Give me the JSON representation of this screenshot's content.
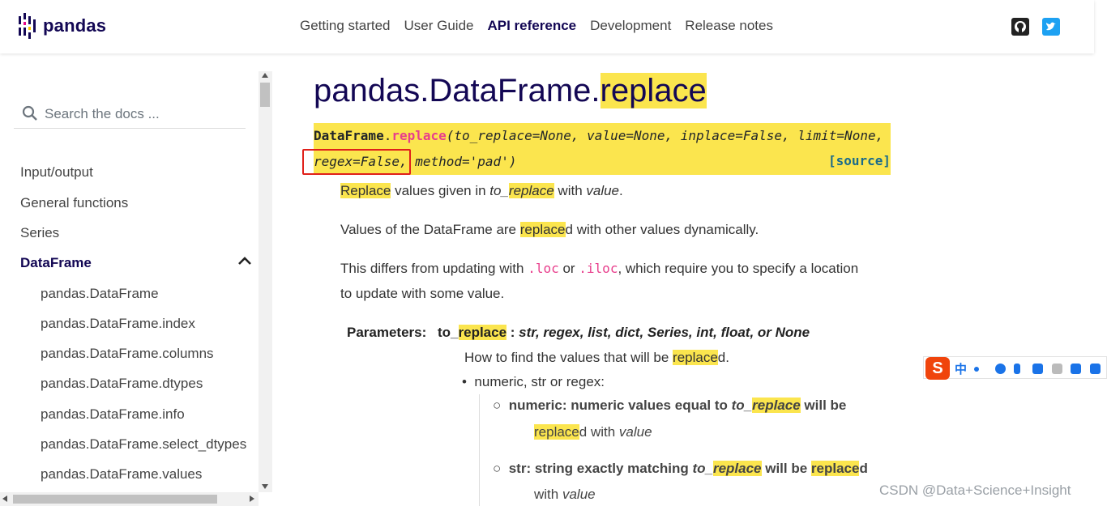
{
  "brand": {
    "name": "pandas",
    "color": "#130754"
  },
  "nav": {
    "links": [
      {
        "label": "Getting started",
        "active": false
      },
      {
        "label": "User Guide",
        "active": false
      },
      {
        "label": "API reference",
        "active": true
      },
      {
        "label": "Development",
        "active": false
      },
      {
        "label": "Release notes",
        "active": false
      }
    ],
    "icons": [
      "github-icon",
      "twitter-icon"
    ]
  },
  "sidebar": {
    "search_placeholder": "Search the docs ...",
    "items": [
      {
        "label": "Input/output"
      },
      {
        "label": "General functions"
      },
      {
        "label": "Series"
      },
      {
        "label": "DataFrame",
        "active": true,
        "expanded": true
      }
    ],
    "subitems": [
      {
        "label": "pandas.DataFrame"
      },
      {
        "label": "pandas.DataFrame.index"
      },
      {
        "label": "pandas.DataFrame.columns"
      },
      {
        "label": "pandas.DataFrame.dtypes"
      },
      {
        "label": "pandas.DataFrame.info"
      },
      {
        "label": "pandas.DataFrame.select_dtypes"
      },
      {
        "label": "pandas.DataFrame.values"
      }
    ]
  },
  "content": {
    "title_prefix": "pandas.DataFrame.",
    "title_highlight": "replace",
    "signature": {
      "class": "DataFrame",
      "dot": ".",
      "method": "replace",
      "line1_args": "(to_replace=None, value=None, inplace=False, limit=None,",
      "line2_boxed": "regex=False,",
      "line2_rest": " method='pad')",
      "source_label": "[source]"
    },
    "p1": {
      "hl": "Replace",
      "t1": " values given in ",
      "em1a": "to_",
      "em1b": "replace",
      "t2": " with ",
      "em2": "value",
      "t3": "."
    },
    "p2": {
      "t1": "Values of the DataFrame are ",
      "hl": "replace",
      "t2": "d with other values dynamically."
    },
    "p3": {
      "t1": "This differs from updating with ",
      "c1": ".loc",
      "t2": " or ",
      "c2": ".iloc",
      "t3": ", which require you to specify a location",
      "line2": "to update with some value."
    },
    "params": {
      "label": "Parameters:",
      "name_a": "to_",
      "name_b": "replace",
      "sep": " : ",
      "type": "str, regex, list, dict, Series, int, float, or None",
      "desc_a": "How to find the values that will be ",
      "desc_hl": "replace",
      "desc_b": "d.",
      "bullet": "numeric, str or regex:",
      "sub1": {
        "a": "numeric: numeric values equal to ",
        "em_a": "to_",
        "em_hl": "replace",
        "b": " will be",
        "l2_hl": "replace",
        "l2_a": "d with ",
        "l2_em": "value"
      },
      "sub2": {
        "a": "str: string exactly matching ",
        "em_a": "to_",
        "em_hl": "replace",
        "b": " will be ",
        "hl2": "replace",
        "c": "d",
        "l2_a": "with ",
        "l2_em": "value"
      }
    }
  },
  "ime_toolbar": {
    "logo": "S",
    "lang": "中"
  },
  "watermark": "CSDN @Data+Science+Insight",
  "colors": {
    "highlight": "#fbe54e",
    "accent_red": "#e0201a",
    "code_pink": "#e83e8c"
  }
}
